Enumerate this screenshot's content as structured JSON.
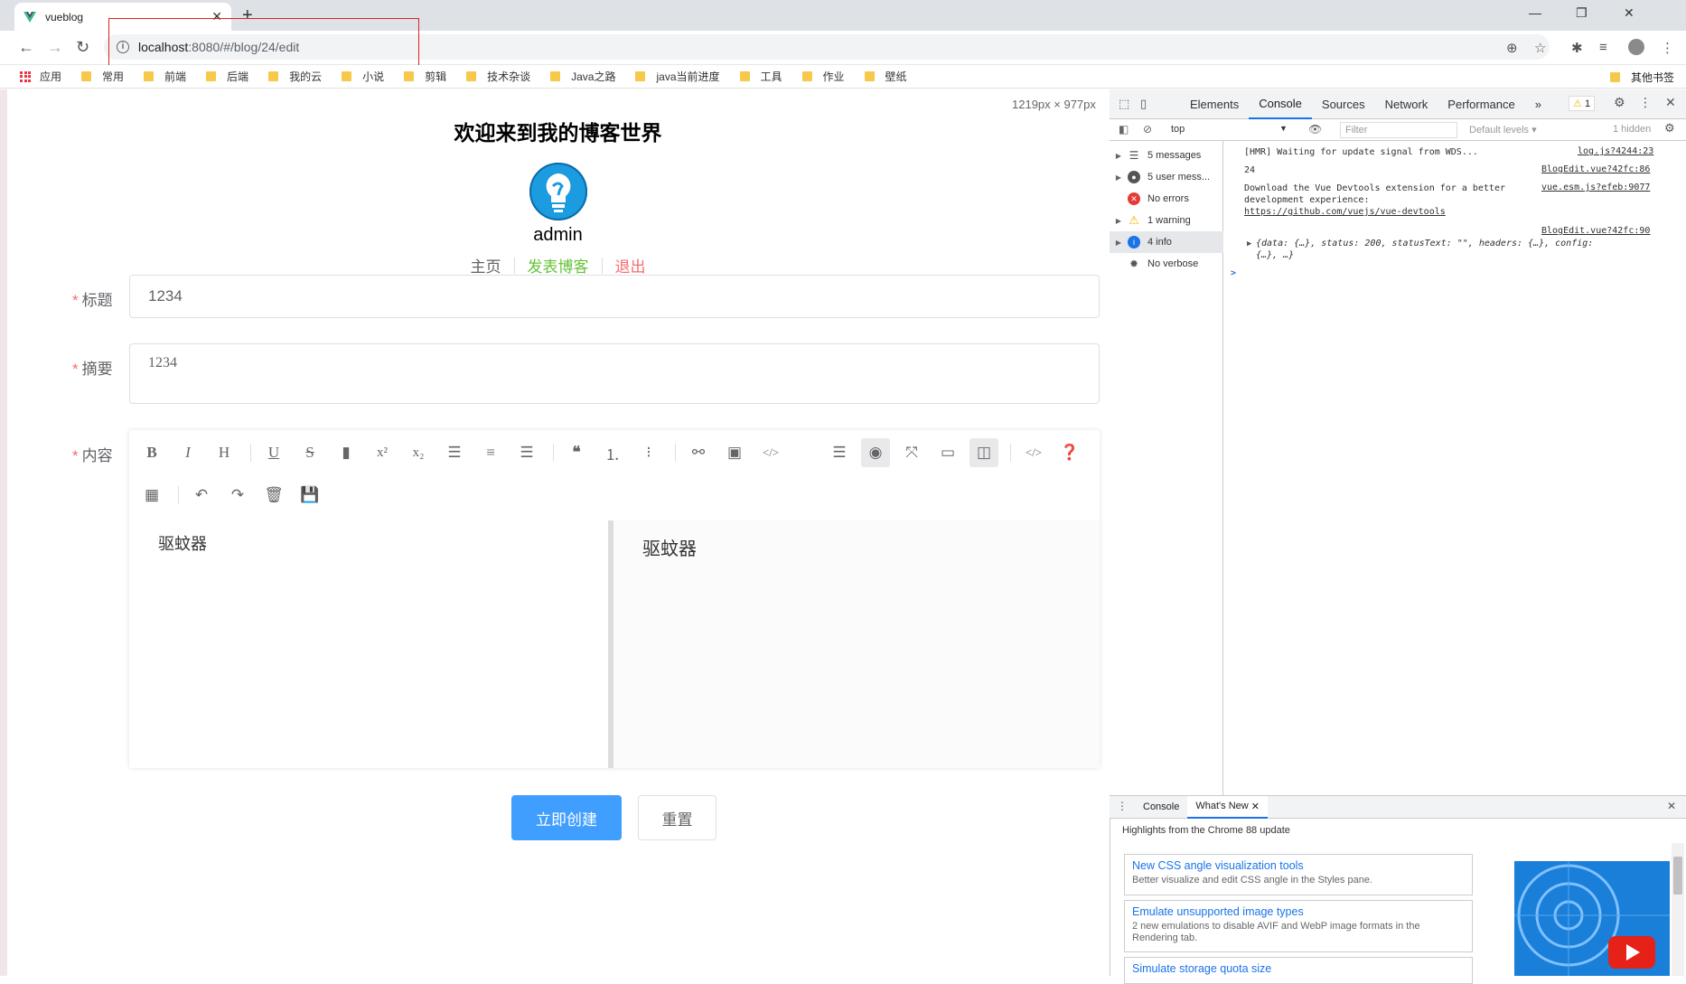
{
  "browser": {
    "tab_title": "vueblog",
    "new_tab_label": "+",
    "url_host": "localhost",
    "url_path": ":8080/#/blog/24/edit",
    "bookmarks": [
      "应用",
      "常用",
      "前端",
      "后端",
      "我的云",
      "小说",
      "剪辑",
      "技术杂谈",
      "Java之路",
      "java当前进度",
      "工具",
      "作业",
      "壁纸"
    ],
    "other_bookmarks": "其他书签"
  },
  "page": {
    "viewport_dims": "1219px × 977px",
    "site_title": "欢迎来到我的博客世界",
    "username": "admin",
    "nav": {
      "home": "主页",
      "publish": "发表博客",
      "logout": "退出"
    },
    "colors": {
      "publish": "#67c23a",
      "logout": "#f56c6c",
      "primary": "#409eff"
    },
    "form": {
      "title_label": "标题",
      "title_value": "1234",
      "summary_label": "摘要",
      "summary_value": "1234",
      "content_label": "内容",
      "required_mark": "*",
      "content_value": "驱蚊器",
      "preview_value": "驱蚊器"
    },
    "buttons": {
      "submit": "立即创建",
      "reset": "重置"
    }
  },
  "devtools": {
    "tabs": [
      "Elements",
      "Console",
      "Sources",
      "Network",
      "Performance"
    ],
    "active_tab": "Console",
    "warning_count": "1",
    "context": "top",
    "filter_placeholder": "Filter",
    "levels": "Default levels ▾",
    "hidden": "1 hidden",
    "sidebar": [
      "5 messages",
      "5 user mess...",
      "No errors",
      "1 warning",
      "4 info",
      "No verbose"
    ],
    "console": [
      {
        "text": "[HMR] Waiting for update signal from WDS...",
        "src": "log.js?4244:23"
      },
      {
        "text": "24",
        "src": "BlogEdit.vue?42fc:86"
      },
      {
        "text": "Download the Vue Devtools extension for a better",
        "text2": "development experience:",
        "link": "https://github.com/vuejs/vue-devtools",
        "src": "vue.esm.js?efeb:9077"
      },
      {
        "src": "BlogEdit.vue?42fc:90",
        "obj1": "{data: {…}, status: 200, statusText: \"\", headers: {…}, config:",
        "obj2": "{…}, …}"
      }
    ],
    "prompt": ">",
    "drawer_tabs": [
      "Console",
      "What's New"
    ],
    "drawer_active": "What's New",
    "highlights": "Highlights from the Chrome 88 update",
    "whats_new": [
      {
        "title": "New CSS angle visualization tools",
        "desc": "Better visualize and edit CSS angle in the Styles pane."
      },
      {
        "title": "Emulate unsupported image types",
        "desc": "2 new emulations to disable AVIF and WebP image formats in the Rendering tab."
      },
      {
        "title": "Simulate storage quota size",
        "desc": ""
      }
    ]
  }
}
